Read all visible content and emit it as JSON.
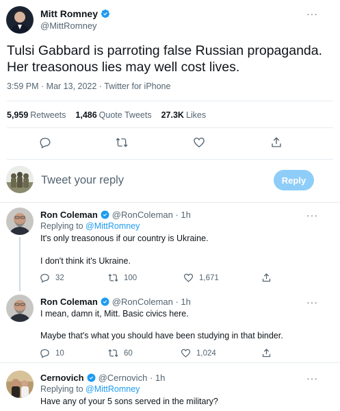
{
  "main_tweet": {
    "author_name": "Mitt Romney",
    "handle": "@MittRomney",
    "text_line1": "Tulsi Gabbard is parroting false Russian propaganda.",
    "text_line2": "Her treasonous lies may well cost lives.",
    "meta": "3:59 PM · Mar 13, 2022 · Twitter for iPhone",
    "retweets_count": "5,959",
    "retweets_label": "Retweets",
    "quotes_count": "1,486",
    "quotes_label": "Quote Tweets",
    "likes_count": "27.3K",
    "likes_label": "Likes",
    "more_glyph": "···",
    "actions": [
      "reply-icon",
      "retweet-icon",
      "like-icon",
      "share-icon"
    ]
  },
  "reply_box": {
    "placeholder": "Tweet your reply",
    "button_label": "Reply",
    "button_color": "#8ecdf8"
  },
  "replies": [
    {
      "name": "Ron Coleman",
      "handle": "@RonColeman · 1h",
      "replying_prefix": "Replying to",
      "replying_to": "@MittRomney",
      "line1": "It's only treasonous if our country is Ukraine.",
      "line2": "I don't think it's Ukraine.",
      "reply_count": "32",
      "retweet_count": "100",
      "like_count": "1,671"
    },
    {
      "name": "Ron Coleman",
      "handle": "@RonColeman · 1h",
      "line1": "I mean, damn it, Mitt. Basic civics here.",
      "line2": "Maybe that's what you should have been studying in that binder.",
      "reply_count": "10",
      "retweet_count": "60",
      "like_count": "1,024"
    },
    {
      "name": "Cernovich",
      "handle": "@Cernovich · 1h",
      "replying_prefix": "Replying to",
      "replying_to": "@MittRomney",
      "line1": "Have any of your 5 sons served in the military?"
    }
  ],
  "colors": {
    "accent": "#1d9bf0",
    "secondary_text": "#536471",
    "verified": "#1d9bf0"
  }
}
